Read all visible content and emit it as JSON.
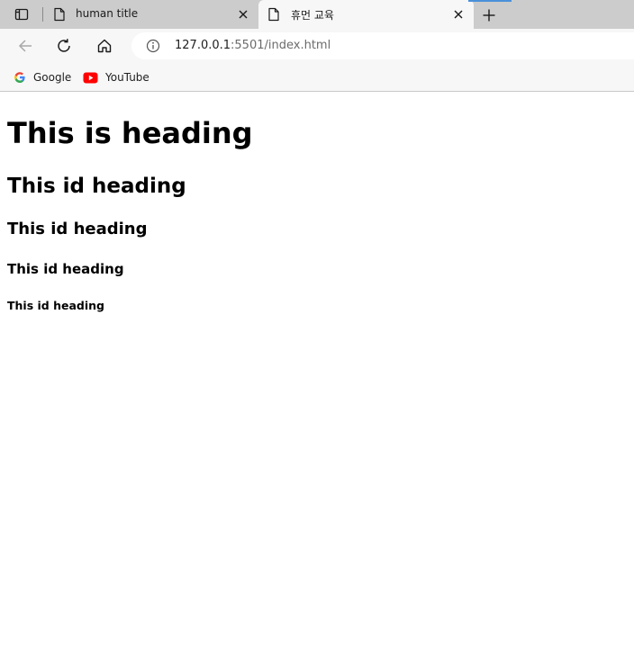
{
  "tabs": [
    {
      "title": "human title",
      "icon": "page-icon",
      "active": false
    },
    {
      "title": "휴먼 교육",
      "icon": "page-icon",
      "active": true
    }
  ],
  "address_bar": {
    "url_host": "127.0.0.1",
    "url_rest": ":5501/index.html",
    "icon": "info-icon"
  },
  "toolbar_icons": [
    "back-arrow-icon",
    "refresh-icon",
    "home-icon"
  ],
  "bookmarks": [
    {
      "label": "Google",
      "icon": "google-icon"
    },
    {
      "label": "YouTube",
      "icon": "youtube-icon"
    }
  ],
  "page": {
    "h1": "This is heading",
    "h2": "This id heading",
    "h3": "This id heading",
    "h4": "This id heading",
    "h5": "This id heading"
  },
  "colors": {
    "tabstrip": "#cccccc",
    "toolbar": "#f7f7f7",
    "accent": "#4a90d9",
    "youtube_red": "#ff0000"
  }
}
